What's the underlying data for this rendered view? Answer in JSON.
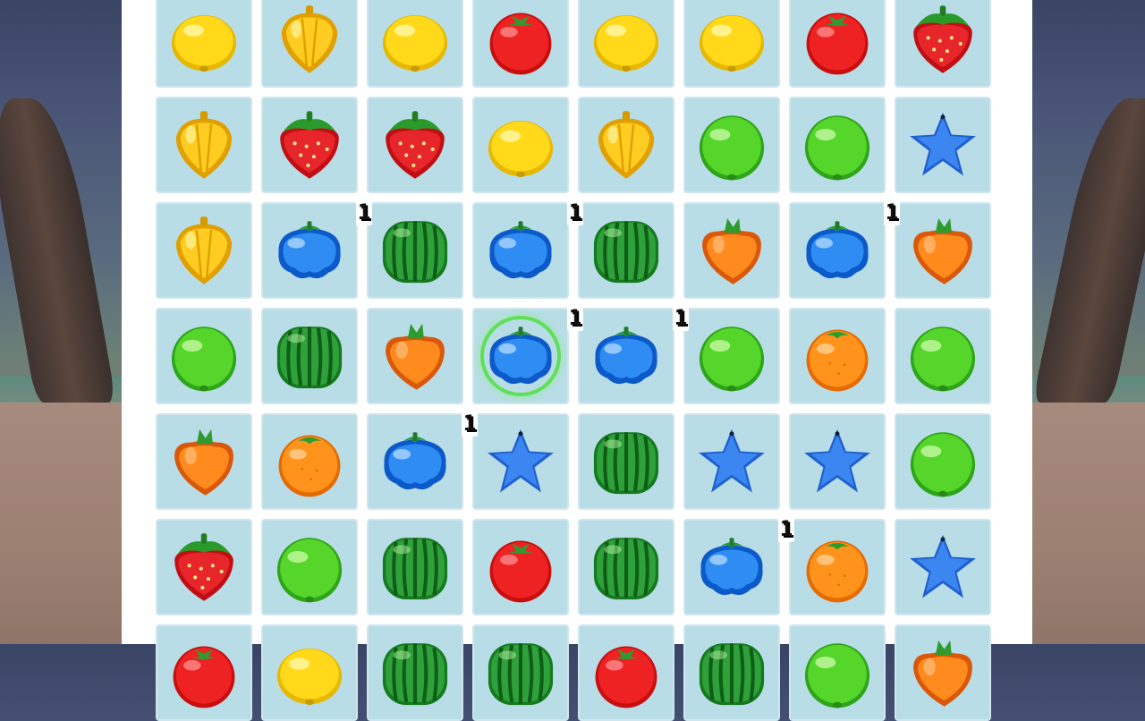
{
  "board": {
    "rows": [
      [
        {
          "fruit": "lemon",
          "badge": ""
        },
        {
          "fruit": "pepper",
          "badge": ""
        },
        {
          "fruit": "lemon",
          "badge": ""
        },
        {
          "fruit": "tomato",
          "badge": ""
        },
        {
          "fruit": "lemon",
          "badge": ""
        },
        {
          "fruit": "lemon",
          "badge": ""
        },
        {
          "fruit": "tomato",
          "badge": ""
        },
        {
          "fruit": "strawberry",
          "badge": ""
        }
      ],
      [
        {
          "fruit": "pepper",
          "badge": ""
        },
        {
          "fruit": "strawberry",
          "badge": ""
        },
        {
          "fruit": "strawberry",
          "badge": ""
        },
        {
          "fruit": "lemon",
          "badge": ""
        },
        {
          "fruit": "pepper",
          "badge": ""
        },
        {
          "fruit": "lime",
          "badge": ""
        },
        {
          "fruit": "lime",
          "badge": ""
        },
        {
          "fruit": "star",
          "badge": ""
        }
      ],
      [
        {
          "fruit": "pepper",
          "badge": ""
        },
        {
          "fruit": "blueberry",
          "badge": "1"
        },
        {
          "fruit": "watermelon",
          "badge": ""
        },
        {
          "fruit": "blueberry",
          "badge": "1"
        },
        {
          "fruit": "watermelon",
          "badge": ""
        },
        {
          "fruit": "carrot",
          "badge": ""
        },
        {
          "fruit": "blueberry",
          "badge": "1"
        },
        {
          "fruit": "carrot",
          "badge": ""
        }
      ],
      [
        {
          "fruit": "lime",
          "badge": ""
        },
        {
          "fruit": "watermelon",
          "badge": ""
        },
        {
          "fruit": "carrot",
          "badge": ""
        },
        {
          "fruit": "blueberry",
          "badge": "1",
          "selected": true
        },
        {
          "fruit": "blueberry",
          "badge": "1"
        },
        {
          "fruit": "lime",
          "badge": ""
        },
        {
          "fruit": "orange",
          "badge": ""
        },
        {
          "fruit": "lime",
          "badge": ""
        }
      ],
      [
        {
          "fruit": "carrot",
          "badge": ""
        },
        {
          "fruit": "orange",
          "badge": ""
        },
        {
          "fruit": "blueberry",
          "badge": "1"
        },
        {
          "fruit": "star",
          "badge": ""
        },
        {
          "fruit": "watermelon",
          "badge": ""
        },
        {
          "fruit": "star",
          "badge": ""
        },
        {
          "fruit": "star",
          "badge": ""
        },
        {
          "fruit": "lime",
          "badge": ""
        }
      ],
      [
        {
          "fruit": "strawberry",
          "badge": ""
        },
        {
          "fruit": "lime",
          "badge": ""
        },
        {
          "fruit": "watermelon",
          "badge": ""
        },
        {
          "fruit": "tomato",
          "badge": ""
        },
        {
          "fruit": "watermelon",
          "badge": ""
        },
        {
          "fruit": "blueberry",
          "badge": "1"
        },
        {
          "fruit": "orange",
          "badge": ""
        },
        {
          "fruit": "star",
          "badge": ""
        }
      ],
      [
        {
          "fruit": "tomato",
          "badge": ""
        },
        {
          "fruit": "lemon",
          "badge": ""
        },
        {
          "fruit": "watermelon",
          "badge": ""
        },
        {
          "fruit": "watermelon",
          "badge": ""
        },
        {
          "fruit": "tomato",
          "badge": ""
        },
        {
          "fruit": "watermelon",
          "badge": ""
        },
        {
          "fruit": "lime",
          "badge": ""
        },
        {
          "fruit": "carrot",
          "badge": ""
        }
      ]
    ]
  },
  "colors": {
    "selection": "#5fe05a",
    "cell": "#b9dde6",
    "board": "#dcebf2"
  }
}
